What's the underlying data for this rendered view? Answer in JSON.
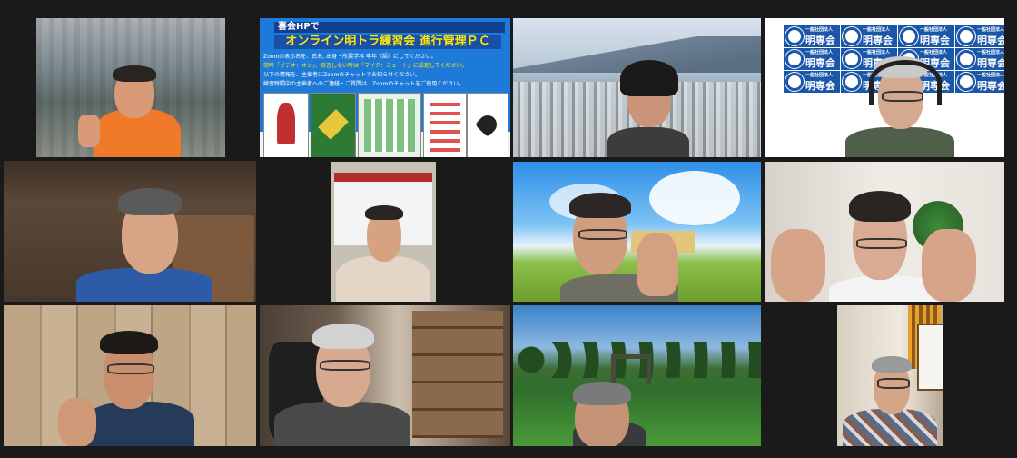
{
  "meeting": {
    "view": "gallery",
    "participant_count": 12
  },
  "tiles": [
    {
      "id": "p1",
      "background": "station-rooftop",
      "gesture": "thumbs-up",
      "shirt": "orange"
    },
    {
      "id": "p2",
      "background": "slide",
      "slide": {
        "header": "喜会HPで",
        "title": "オンライン明トラ練習会 進行管理ＰＣ",
        "lines": [
          "Zoomの表示名を、氏名, 出身・所属学科 卒年（語）にしてください。",
          "常時「ビデオ：オン」、発言しない時は「マイク：ミュート」に設定してください。",
          "以下の情報を、主催者にZoomのチャットでお知らせください。",
          "練習時間中の主催者へのご連絡・ご質問は、Zoomのチャットをご使用ください。"
        ]
      }
    },
    {
      "id": "p3",
      "background": "city-harbor-view",
      "shirt": "dark"
    },
    {
      "id": "p4",
      "background": "logo-backdrop",
      "backdrop_text": "明専会",
      "backdrop_subtext": "一般社団法人",
      "accessory": "headphones"
    },
    {
      "id": "p5",
      "background": "room-wood-door",
      "active_speaker": true,
      "shirt": "blue"
    },
    {
      "id": "p6",
      "background": "hockey-jersey-wall",
      "shirt": "beige"
    },
    {
      "id": "p7",
      "background": "anime-sky-field",
      "gesture": "wave"
    },
    {
      "id": "p8",
      "background": "white-room-plant",
      "gesture": "both-hands-wave"
    },
    {
      "id": "p9",
      "background": "wooden-planks",
      "gesture": "wave"
    },
    {
      "id": "p10",
      "background": "home-office-shelf"
    },
    {
      "id": "p11",
      "background": "park-grass-trees"
    },
    {
      "id": "p12",
      "background": "home-room-curtain",
      "shirt": "plaid"
    }
  ],
  "colors": {
    "window_bg": "#1a1a1a",
    "active_outline": "#e8d44a",
    "slide_blue": "#1e7ad8",
    "slide_title_text": "#ffe800",
    "logo_blue": "#1b57a8"
  }
}
